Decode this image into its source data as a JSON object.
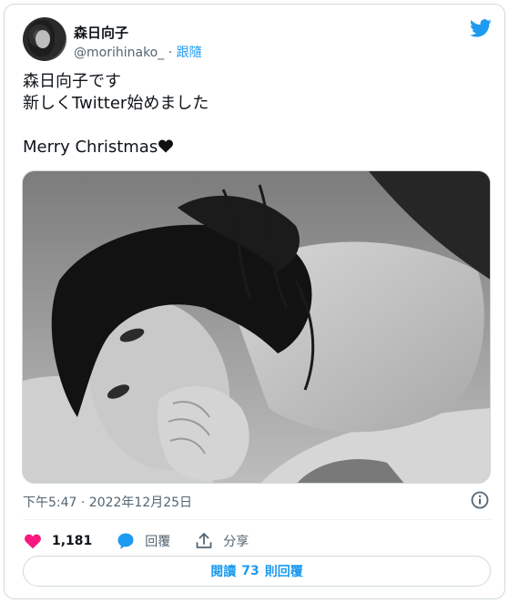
{
  "user": {
    "display_name": "森日向子",
    "handle": "@morihinako_",
    "separator": "·",
    "follow_label": "跟隨"
  },
  "tweet": {
    "lines": [
      "森日向子です",
      "新しくTwitter始めました",
      "",
      "Merry Christmas"
    ],
    "trailing_emoji": "black-heart"
  },
  "meta": {
    "timestamp": "下午5:47 · 2022年12月25日"
  },
  "actions": {
    "like_count": "1,181",
    "reply_label": "回覆",
    "share_label": "分享"
  },
  "replies": {
    "prefix": "閱讀",
    "count": "73",
    "suffix": "則回覆"
  },
  "colors": {
    "accent": "#1d9bf0",
    "like": "#f91880",
    "text": "#0f1419",
    "muted": "#536471",
    "border": "#cfd9de"
  },
  "icons": [
    "twitter-bird-icon",
    "info-icon",
    "heart-icon",
    "reply-bubble-icon",
    "share-icon"
  ]
}
